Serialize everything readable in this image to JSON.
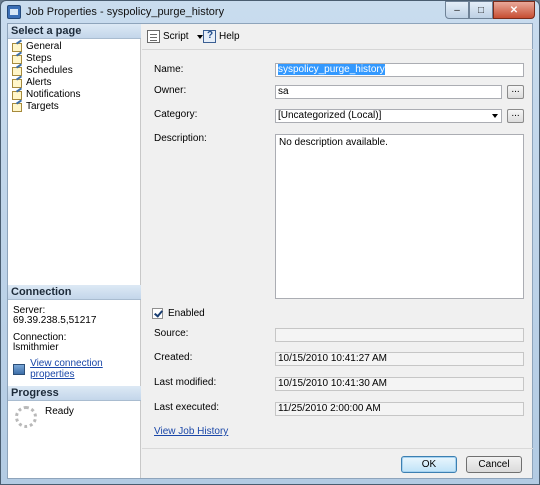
{
  "window": {
    "title": "Job Properties - syspolicy_purge_history"
  },
  "left_pane": {
    "select_header": "Select a page",
    "pages": [
      "General",
      "Steps",
      "Schedules",
      "Alerts",
      "Notifications",
      "Targets"
    ],
    "connection_header": "Connection",
    "server_label": "Server:",
    "server_value": "69.39.238.5,51217",
    "connection_label": "Connection:",
    "connection_value": "lsmithmier",
    "view_connection_link": "View connection properties",
    "progress_header": "Progress",
    "progress_status": "Ready"
  },
  "toolbar": {
    "script_label": "Script",
    "help_label": "Help"
  },
  "form": {
    "name_label": "Name:",
    "name_value": "syspolicy_purge_history",
    "owner_label": "Owner:",
    "owner_value": "sa",
    "category_label": "Category:",
    "category_value": "[Uncategorized (Local)]",
    "description_label": "Description:",
    "description_value": "No description available.",
    "enabled_label": "Enabled",
    "source_label": "Source:",
    "source_value": "",
    "created_label": "Created:",
    "created_value": "10/15/2010 10:41:27 AM",
    "last_modified_label": "Last modified:",
    "last_modified_value": "10/15/2010 10:41:30 AM",
    "last_executed_label": "Last executed:",
    "last_executed_value": "11/25/2010 2:00:00 AM",
    "view_history_link": "View Job History",
    "ellipsis": "..."
  },
  "buttons": {
    "ok": "OK",
    "cancel": "Cancel"
  },
  "colors": {
    "accent": "#3399ff",
    "link": "#1a47a8"
  }
}
